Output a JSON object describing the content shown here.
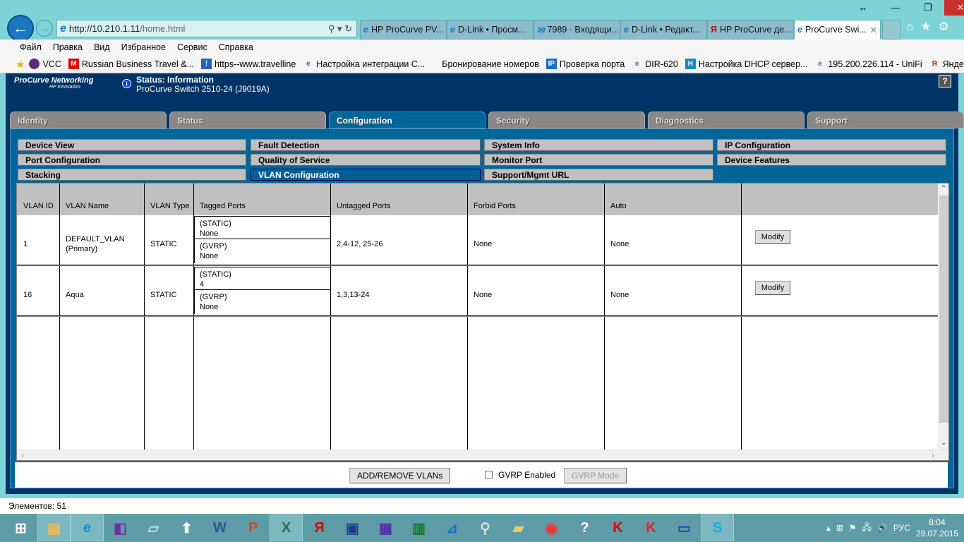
{
  "browser": {
    "address": "http://10.210.1.11/home.html",
    "address_host": "http://10.210.1.11",
    "address_path": "/home.html",
    "tabs": [
      {
        "label": "HP ProCurve PV...",
        "icon": "ie-icon"
      },
      {
        "label": "D-Link • Просм...",
        "icon": "ie-icon"
      },
      {
        "label": "7989 · Входящи...",
        "icon": "mail-icon"
      },
      {
        "label": "D-Link • Редакт...",
        "icon": "ie-icon"
      },
      {
        "label": "HP ProCurve де...",
        "icon": "yandex-icon"
      },
      {
        "label": "ProCurve Swi...",
        "icon": "ie-icon",
        "active": true
      }
    ],
    "menu": [
      "Файл",
      "Правка",
      "Вид",
      "Избранное",
      "Сервис",
      "Справка"
    ],
    "favorites": [
      "VCC",
      "Russian Business Travel &...",
      "https--www.travelline",
      "Настройка интеграции С...",
      "Бронирование номеров",
      "Проверка порта",
      "DIR-620",
      "Настройка DHCP сервер...",
      "195.200.226.114 - UniFi",
      "Яндекс"
    ],
    "status_text": "Элементов: 51"
  },
  "page": {
    "logo": "ProCurve Networking",
    "logo_sub": "HP Innovation",
    "status_label": "Status:  Information",
    "device": "ProCurve Switch 2510-24 (J9019A)",
    "help": "?",
    "main_tabs": [
      "Identity",
      "Status",
      "Configuration",
      "Security",
      "Diagnostics",
      "Support"
    ],
    "active_tab": "Configuration",
    "sub_tabs": [
      [
        "Device View",
        "Fault Detection",
        "System Info",
        "IP Configuration"
      ],
      [
        "Port Configuration",
        "Quality of Service",
        "Monitor Port",
        "Device Features"
      ],
      [
        "Stacking",
        "VLAN Configuration",
        "Support/Mgmt URL"
      ]
    ],
    "active_sub_tab": "VLAN Configuration",
    "table": {
      "headers": [
        "VLAN ID",
        "VLAN Name",
        "VLAN Type",
        "Tagged Ports",
        "Untagged Ports",
        "Forbid Ports",
        "Auto"
      ],
      "rows": [
        {
          "id": "1",
          "name": "DEFAULT_VLAN",
          "name2": "(Primary)",
          "type": "STATIC",
          "tag_static_label": "(STATIC)",
          "tag_static": "None",
          "tag_gvrp_label": "(GVRP)",
          "tag_gvrp": "None",
          "untagged": "2,4-12, 25-26",
          "forbid": "None",
          "auto": "None",
          "action": "Modify"
        },
        {
          "id": "16",
          "name": "Aqua",
          "name2": "",
          "type": "STATIC",
          "tag_static_label": "(STATIC)",
          "tag_static": "4",
          "tag_gvrp_label": "(GVRP)",
          "tag_gvrp": "None",
          "untagged": "1,3,13-24",
          "forbid": "None",
          "auto": "None",
          "action": "Modify"
        }
      ]
    },
    "add_remove": "ADD/REMOVE VLANs",
    "gvrp_enabled": "GVRP Enabled",
    "gvrp_enabled_checked": false,
    "gvrp_mode": "GVRP Mode"
  },
  "taskbar": {
    "lang": "РУС",
    "time": "8:04",
    "date": "29.07.2015"
  }
}
